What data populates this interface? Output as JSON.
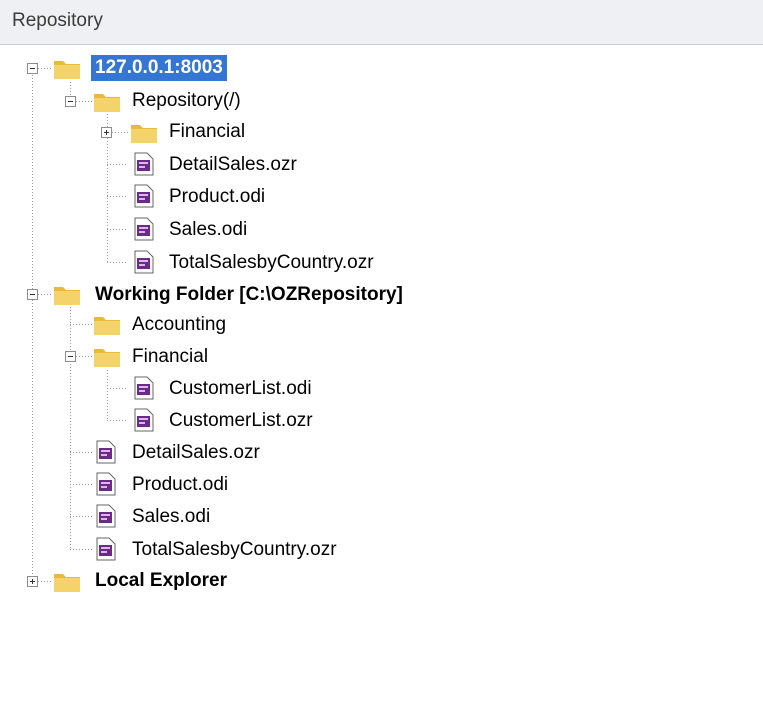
{
  "panel": {
    "title": "Repository"
  },
  "tree": {
    "server": {
      "label": "127.0.0.1:8003"
    },
    "repo": {
      "label": "Repository(/)"
    },
    "repo_financial": {
      "label": "Financial"
    },
    "repo_files": [
      "DetailSales.ozr",
      "Product.odi",
      "Sales.odi",
      "TotalSalesbyCountry.ozr"
    ],
    "working": {
      "label": "Working Folder [C:\\OZRepository]"
    },
    "accounting": {
      "label": "Accounting"
    },
    "wf_financial": {
      "label": "Financial"
    },
    "wf_financial_files": [
      "CustomerList.odi",
      "CustomerList.ozr"
    ],
    "wf_files": [
      "DetailSales.ozr",
      "Product.odi",
      "Sales.odi",
      "TotalSalesbyCountry.ozr"
    ],
    "local": {
      "label": "Local Explorer"
    }
  },
  "colors": {
    "selection": "#3476d2",
    "folder": "#f2c94c",
    "doc_icon": "#6a2a86"
  }
}
